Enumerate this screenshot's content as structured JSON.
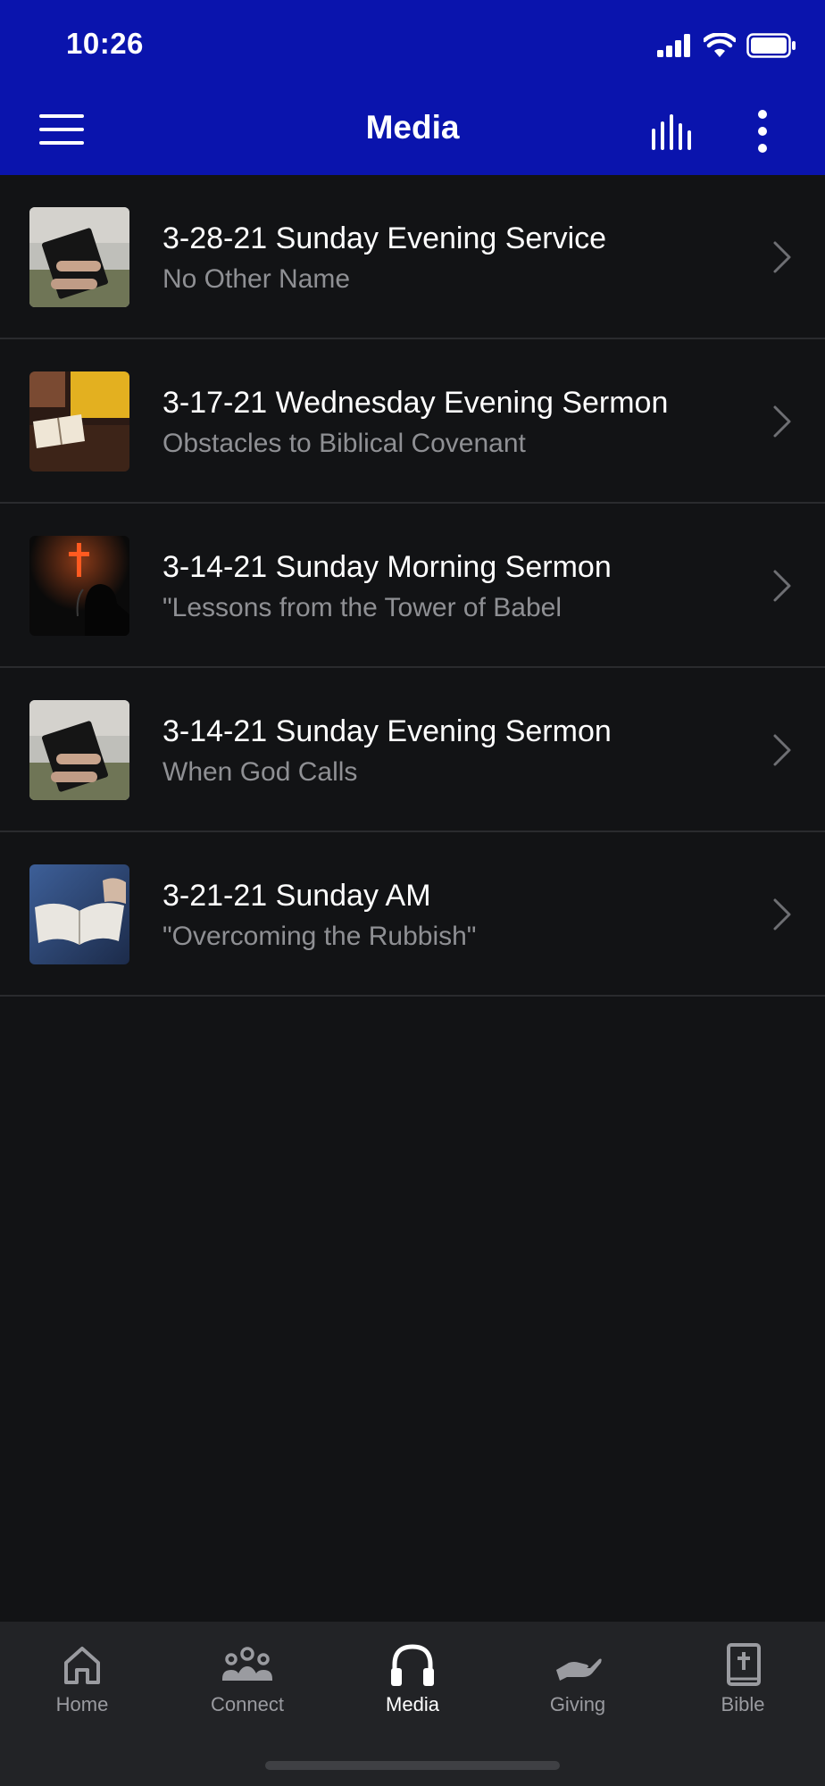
{
  "status_bar": {
    "time": "10:26"
  },
  "nav": {
    "title": "Media",
    "left_icon": "hamburger-menu-icon",
    "right_icons": [
      "audio-bars-icon",
      "more-vertical-icon"
    ]
  },
  "items": [
    {
      "title": "3-28-21 Sunday Evening Service",
      "subtitle": "No Other Name",
      "thumbnail": "hands-holding-bible"
    },
    {
      "title": "3-17-21 Wednesday Evening Sermon",
      "subtitle": "Obstacles to Biblical Covenant",
      "thumbnail": "open-bible-on-table"
    },
    {
      "title": "3-14-21 Sunday Morning Sermon",
      "subtitle": "\"Lessons from the Tower of Babel",
      "thumbnail": "glowing-cross-silhouette"
    },
    {
      "title": "3-14-21 Sunday Evening Sermon",
      "subtitle": "When God Calls",
      "thumbnail": "hands-holding-bible"
    },
    {
      "title": "3-21-21 Sunday AM",
      "subtitle": "\"Overcoming the Rubbish\"",
      "thumbnail": "open-bible-blue"
    }
  ],
  "tabs": [
    {
      "label": "Home",
      "icon": "home-icon",
      "active": false
    },
    {
      "label": "Connect",
      "icon": "people-icon",
      "active": false
    },
    {
      "label": "Media",
      "icon": "headphones-icon",
      "active": true
    },
    {
      "label": "Giving",
      "icon": "giving-hand-icon",
      "active": false
    },
    {
      "label": "Bible",
      "icon": "bible-icon",
      "active": false
    }
  ],
  "colors": {
    "header": "#0a14ad",
    "background": "#121315",
    "tabbar": "#222326",
    "subtitle": "#8f9094"
  }
}
